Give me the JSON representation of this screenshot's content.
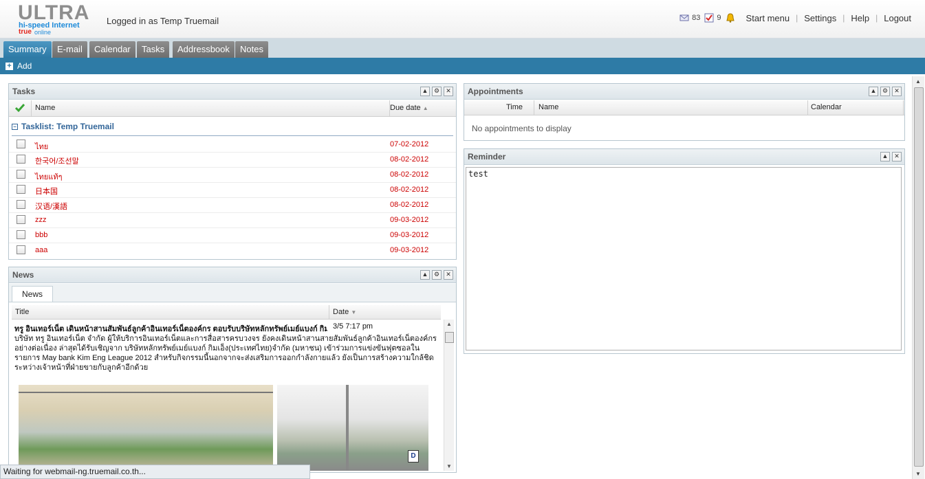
{
  "header": {
    "logo_big": "ULTRA",
    "logo_sub": "hi-speed Internet",
    "logo_true": "true",
    "logo_online": "online",
    "logged_in_text": "Logged in as Temp Truemail",
    "mail_count": "83",
    "task_count": "9",
    "links": {
      "start_menu": "Start menu",
      "settings": "Settings",
      "help": "Help",
      "logout": "Logout"
    },
    "separator": "|"
  },
  "tabs": [
    "Summary",
    "E-mail",
    "Calendar",
    "Tasks",
    "Addressbook",
    "Notes"
  ],
  "toolbar": {
    "add_label": "Add"
  },
  "tasks": {
    "title": "Tasks",
    "col_name": "Name",
    "col_due": "Due date",
    "group_label": "Tasklist: Temp Truemail",
    "rows": [
      {
        "name": "ไทย",
        "due": "07-02-2012"
      },
      {
        "name": "한국어/조선말",
        "due": "08-02-2012"
      },
      {
        "name": "ไทยแท้ๆ",
        "due": "08-02-2012"
      },
      {
        "name": "日本国",
        "due": "08-02-2012"
      },
      {
        "name": "汉语/漢語",
        "due": "08-02-2012"
      },
      {
        "name": "zzz",
        "due": "09-03-2012"
      },
      {
        "name": "bbb",
        "due": "09-03-2012"
      },
      {
        "name": "aaa",
        "due": "09-03-2012"
      }
    ]
  },
  "news": {
    "title": "News",
    "tab_label": "News",
    "col_title": "Title",
    "col_date": "Date",
    "item_title": "ทรู อินเทอร์เน็ต เดินหน้าสานสัมพันธ์ลูกค้าอินเทอร์เน็ตองค์กร ตอบรับบริษัทหลักทรัพย์เมย์แบงก์ กิมเ",
    "item_date": "3/5 7:17 pm",
    "item_body": "บริษัท ทรู อินเทอร์เน็ต จำกัด ผู้ให้บริการอินเทอร์เน็ตและการสื่อสารครบวงจร ยังคงเดินหน้าสานสายสัมพันธ์ลูกค้าอินเทอร์เน็ตองค์กรอย่างต่อเนื่อง ล่าสุดได้รับเชิญจาก บริษัทหลักทรัพย์เมย์แบงก์ กิมเอ็ง(ประเทศไทย)จำกัด (มหาชน) เข้าร่วมการแข่งขันฟุตซอลในรายการ May bank Kim Eng League 2012 สำหรับกิจกรรมนี้นอกจากจะส่งเสริมการออกกำลังกายแล้ว ยังเป็นการสร้างความใกล้ชิดระหว่างเจ้าหน้าที่ฝ่ายขายกับลูกค้าอีกด้วย",
    "photo_sign": "D"
  },
  "appointments": {
    "title": "Appointments",
    "col_time": "Time",
    "col_name": "Name",
    "col_calendar": "Calendar",
    "empty_text": "No appointments to display"
  },
  "reminder": {
    "title": "Reminder",
    "text": "test"
  },
  "status_bar": "Waiting for webmail-ng.truemail.co.th...",
  "colors": {
    "accent": "#2e7ba6",
    "task_overdue": "#cc0000",
    "group_link": "#336699"
  }
}
